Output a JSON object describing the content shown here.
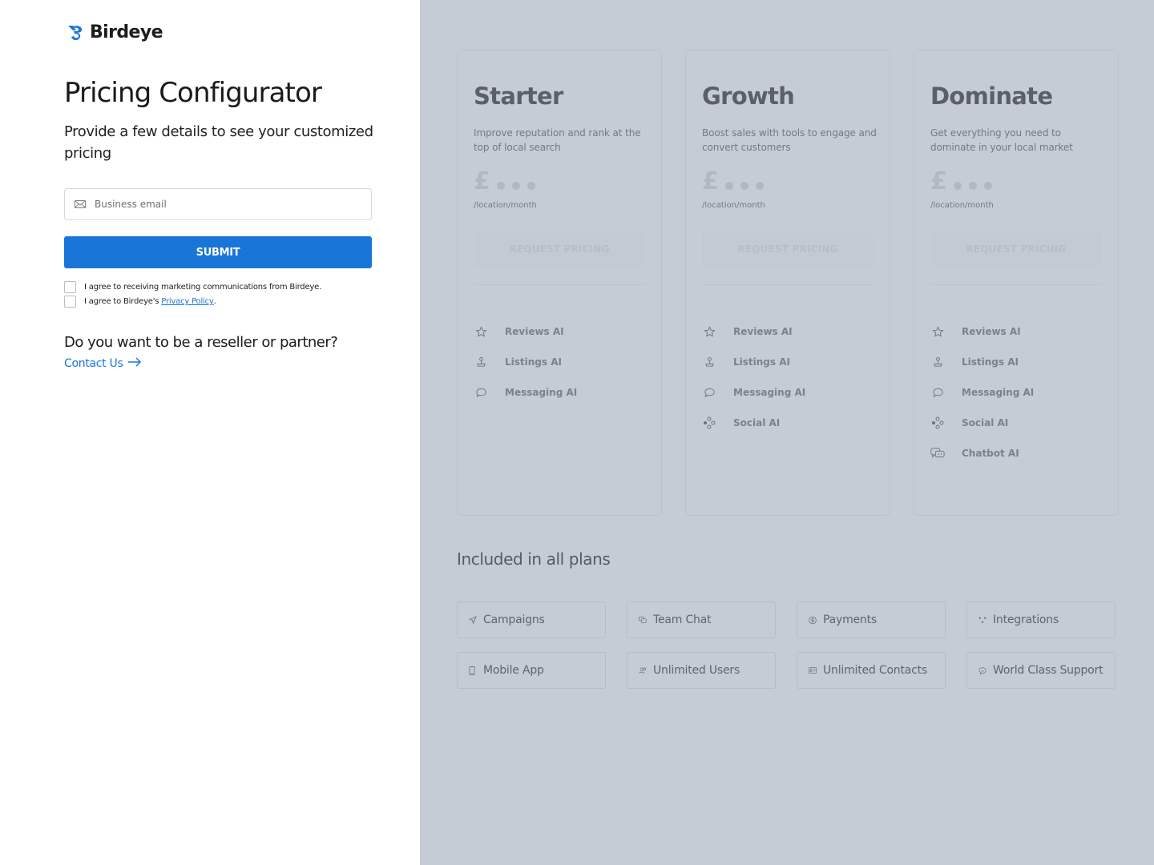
{
  "brand": {
    "name": "Birdeye",
    "color": "#1976d8"
  },
  "form": {
    "title": "Pricing Configurator",
    "subtitle": "Provide a few details to see your customized pricing",
    "email_placeholder": "Business email",
    "submit_label": "SUBMIT",
    "consent_marketing": "I agree to receiving marketing communications from Birdeye.",
    "consent_privacy_prefix": "I agree to Birdeye's ",
    "privacy_link": "Privacy Policy",
    "consent_privacy_suffix": ".",
    "reseller_question": "Do you want to be a reseller or partner?",
    "contact_label": "Contact Us"
  },
  "plans": [
    {
      "name": "Starter",
      "description": "Improve reputation and rank at the top of local search",
      "currency": "£",
      "per": "/location/month",
      "cta": "REQUEST PRICING",
      "features": [
        {
          "icon": "star-icon",
          "label": "Reviews AI"
        },
        {
          "icon": "map-pin-icon",
          "label": "Listings AI"
        },
        {
          "icon": "chat-bubble-icon",
          "label": "Messaging AI"
        }
      ]
    },
    {
      "name": "Growth",
      "description": "Boost sales with tools to engage and convert customers",
      "currency": "£",
      "per": "/location/month",
      "cta": "REQUEST PRICING",
      "features": [
        {
          "icon": "star-icon",
          "label": "Reviews AI"
        },
        {
          "icon": "map-pin-icon",
          "label": "Listings AI"
        },
        {
          "icon": "chat-bubble-icon",
          "label": "Messaging AI"
        },
        {
          "icon": "social-network-icon",
          "label": "Social AI"
        }
      ]
    },
    {
      "name": "Dominate",
      "description": "Get everything you need to dominate in your local market",
      "currency": "£",
      "per": "/location/month",
      "cta": "REQUEST PRICING",
      "features": [
        {
          "icon": "star-icon",
          "label": "Reviews AI"
        },
        {
          "icon": "map-pin-icon",
          "label": "Listings AI"
        },
        {
          "icon": "chat-bubble-icon",
          "label": "Messaging AI"
        },
        {
          "icon": "social-network-icon",
          "label": "Social AI"
        },
        {
          "icon": "chatbot-icon",
          "label": "Chatbot AI"
        }
      ]
    }
  ],
  "included": {
    "title": "Included in all plans",
    "items": [
      {
        "icon": "send-icon",
        "label": "Campaigns"
      },
      {
        "icon": "team-chat-icon",
        "label": "Team Chat"
      },
      {
        "icon": "payments-icon",
        "label": "Payments"
      },
      {
        "icon": "integrations-icon",
        "label": "Integrations"
      },
      {
        "icon": "mobile-icon",
        "label": "Mobile App"
      },
      {
        "icon": "users-icon",
        "label": "Unlimited Users"
      },
      {
        "icon": "contacts-icon",
        "label": "Unlimited Contacts"
      },
      {
        "icon": "support-icon",
        "label": "World Class Support"
      }
    ]
  }
}
